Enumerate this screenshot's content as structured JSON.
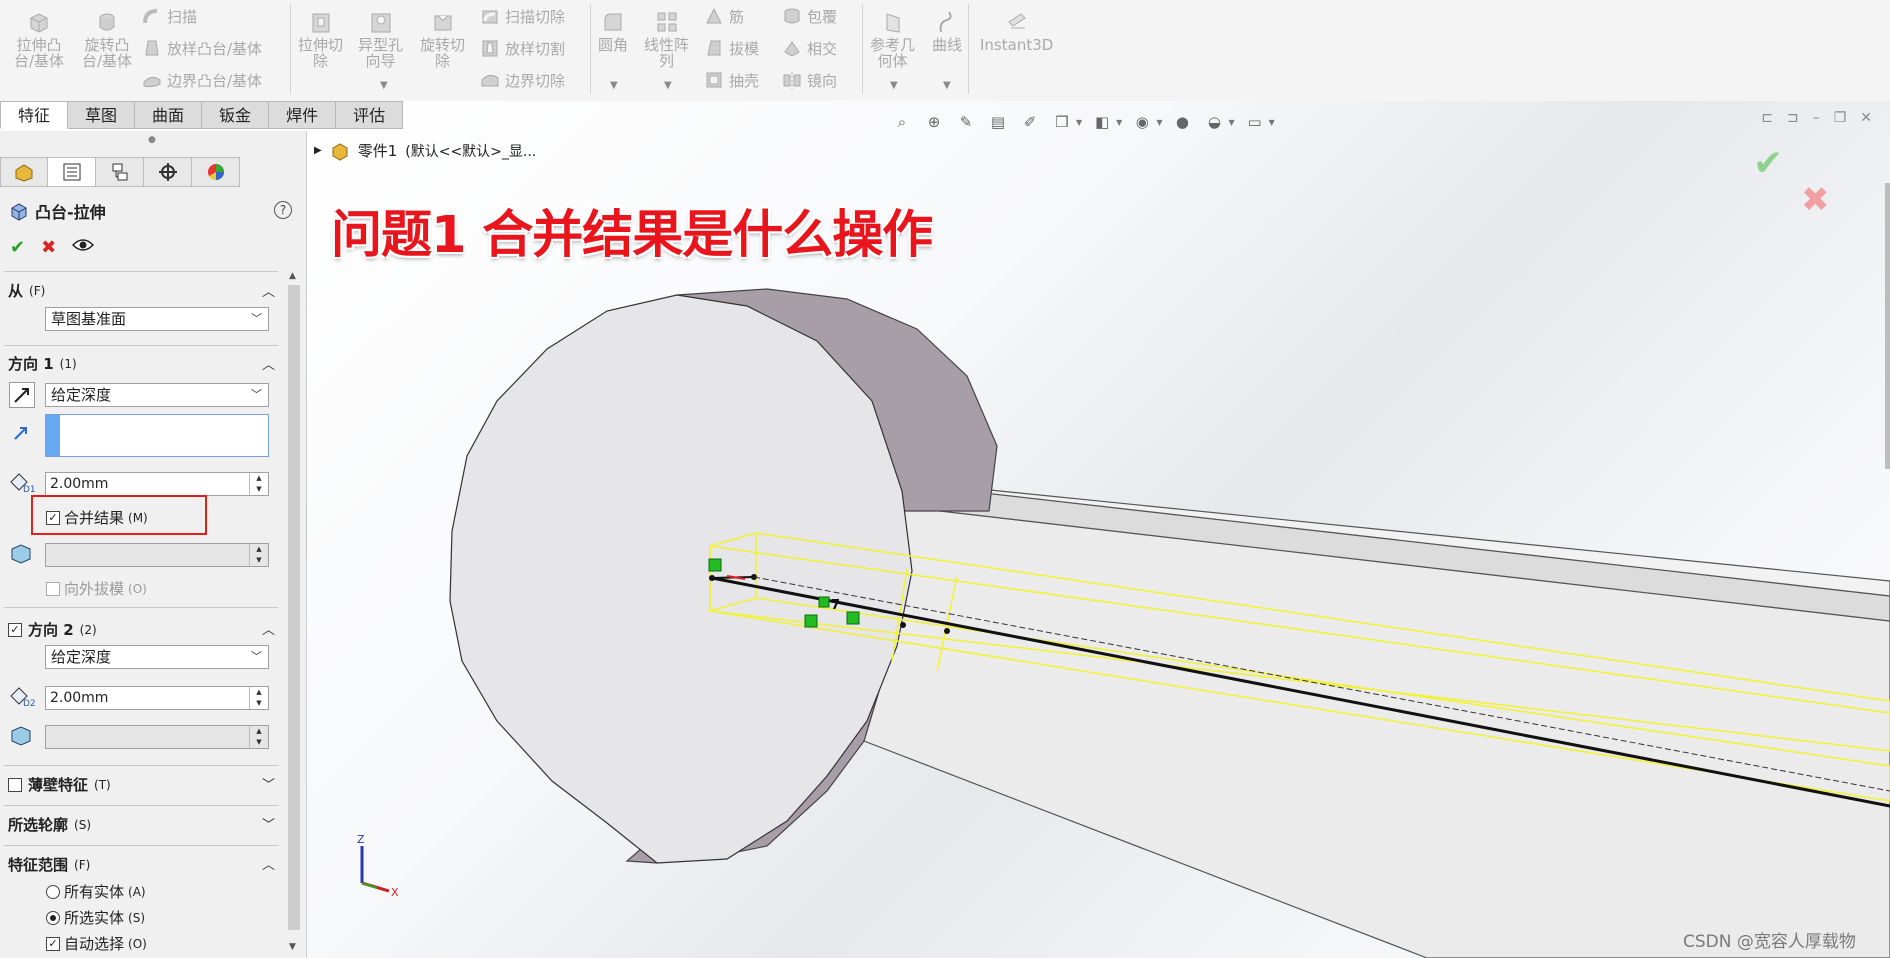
{
  "ribbon": {
    "extrude_boss": [
      "拉伸凸",
      "台/基体"
    ],
    "revolve_boss": [
      "旋转凸",
      "台/基体"
    ],
    "sweep": "扫描",
    "loft_boss": "放样凸台/基体",
    "boundary_boss": "边界凸台/基体",
    "extrude_cut": [
      "拉伸切",
      "除"
    ],
    "hole_wizard": [
      "异型孔",
      "向导"
    ],
    "revolve_cut": [
      "旋转切",
      "除"
    ],
    "swept_cut": "扫描切除",
    "lofted_cut": "放样切割",
    "boundary_cut": "边界切除",
    "fillet": "圆角",
    "linear_pattern": [
      "线性阵",
      "列"
    ],
    "rib": "筋",
    "draft": "拔模",
    "shell": "抽壳",
    "wrap": "包覆",
    "intersect": "相交",
    "mirror": "镜向",
    "ref_geometry": [
      "参考几",
      "何体"
    ],
    "curves": "曲线",
    "instant3d": "Instant3D"
  },
  "cmd_tabs": [
    "特征",
    "草图",
    "曲面",
    "钣金",
    "焊件",
    "评估"
  ],
  "panel": {
    "title": "凸台-拉伸",
    "help": "?",
    "ok": "✔",
    "cancel": "✖",
    "from": {
      "label": "从",
      "accel": "(F)",
      "value": "草图基准面"
    },
    "dir1": {
      "label": "方向 1",
      "accel": "(1)",
      "type": "给定深度",
      "depth": "2.00mm"
    },
    "merge": {
      "label": "合并结果",
      "accel": "(M)",
      "checked": true,
      "highlight_color": "#e0201c"
    },
    "draft_out": {
      "label": "向外拔模",
      "accel": "(O)",
      "checked": false
    },
    "dir2": {
      "label": "方向 2",
      "accel": "(2)",
      "checked": true,
      "type": "给定深度",
      "depth": "2.00mm"
    },
    "thin": {
      "label": "薄壁特征",
      "accel": "(T)",
      "checked": false
    },
    "contours": {
      "label": "所选轮廓",
      "accel": "(S)"
    },
    "scope": {
      "label": "特征范围",
      "accel": "(F)",
      "all": {
        "label": "所有实体",
        "accel": "(A)",
        "selected": false
      },
      "selected": {
        "label": "所选实体",
        "accel": "(S)",
        "selected": true
      },
      "auto": {
        "label": "自动选择",
        "accel": "(O)",
        "checked": true
      }
    }
  },
  "graphics": {
    "tree_item": "零件1",
    "tree_config": "(默认<<默认>_显...",
    "overlay_title": "问题1 合并结果是什么操作",
    "dim_label": "7",
    "axis_x": "X",
    "axis_z": "Z",
    "watermark": "CSDN @宽容人厚载物",
    "colors": {
      "overlay": "#e8151c",
      "preview": "#f2f230",
      "marker": "#22bb22"
    }
  }
}
